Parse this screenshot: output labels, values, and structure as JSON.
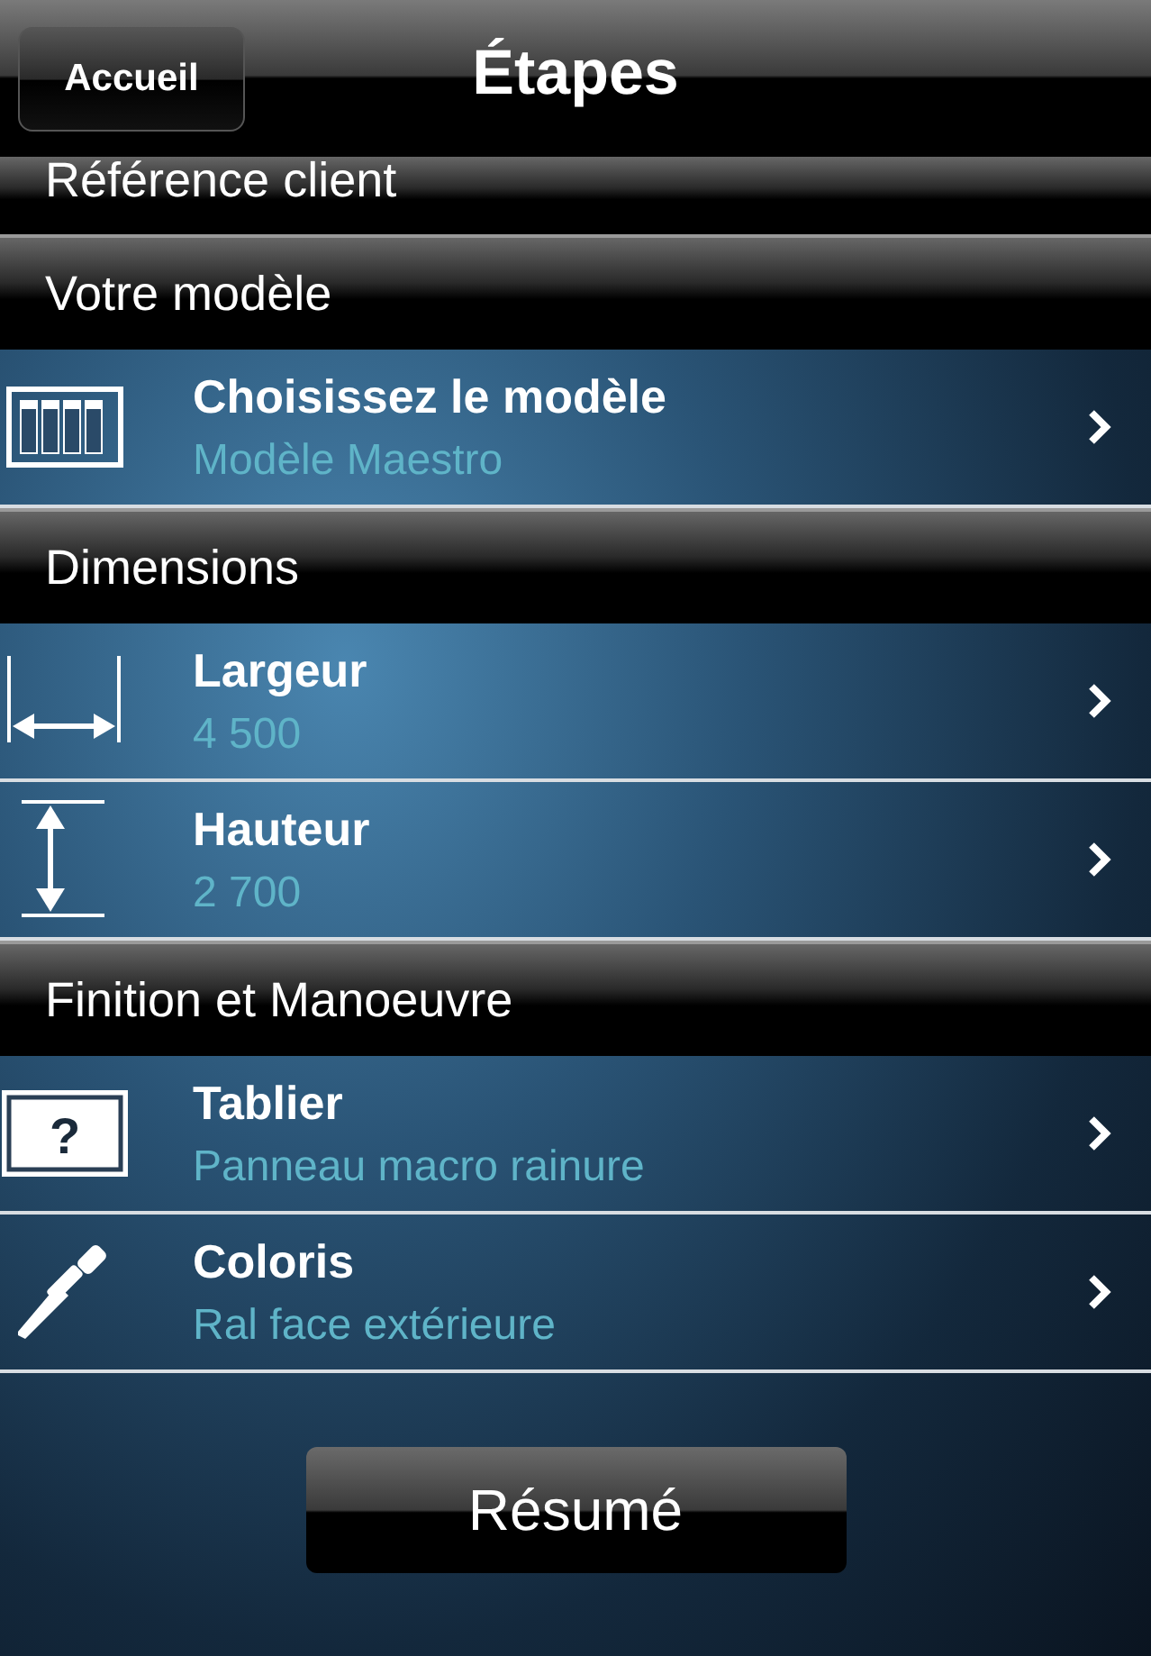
{
  "nav": {
    "back": "Accueil",
    "title": "Étapes"
  },
  "sections": [
    {
      "header": "Référence client"
    },
    {
      "header": "Votre modèle",
      "rows": [
        {
          "kind": "model",
          "title": "Choisissez le modèle",
          "value": "Modèle Maestro"
        }
      ]
    },
    {
      "header": "Dimensions",
      "rows": [
        {
          "kind": "width",
          "title": "Largeur",
          "value": "4 500"
        },
        {
          "kind": "height",
          "title": "Hauteur",
          "value": "2 700"
        }
      ]
    },
    {
      "header": "Finition et Manoeuvre",
      "rows": [
        {
          "kind": "panel",
          "icon_label": "?",
          "title": "Tablier",
          "value": "Panneau macro rainure"
        },
        {
          "kind": "dropper",
          "title": "Coloris",
          "value": "Ral face extérieure"
        }
      ]
    }
  ],
  "summary_button": "Résumé"
}
